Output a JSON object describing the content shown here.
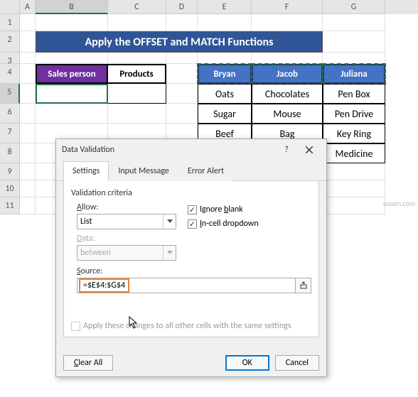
{
  "columns": [
    "A",
    "B",
    "C",
    "D",
    "E",
    "F",
    "G"
  ],
  "rows": [
    "1",
    "2",
    "3",
    "4",
    "5",
    "6",
    "7",
    "8",
    "9",
    "10",
    "11"
  ],
  "banner": "Apply the OFFSET and MATCH Functions",
  "left_headers": {
    "sales": "Sales person",
    "products": "Products"
  },
  "right_headers": [
    "Bryan",
    "Jacob",
    "Juliana"
  ],
  "table": [
    [
      "Oats",
      "Chocolates",
      "Pen Box"
    ],
    [
      "Sugar",
      "Mouse",
      "Pen Drive"
    ],
    [
      "Beef",
      "Bag",
      "Key Ring"
    ],
    [
      "",
      "",
      "Medicine"
    ]
  ],
  "dialog": {
    "title": "Data Validation",
    "tabs": [
      "Settings",
      "Input Message",
      "Error Alert"
    ],
    "criteria": "Validation criteria",
    "allow_lbl": "Allow:",
    "allow_val": "List",
    "data_lbl": "Data:",
    "data_val": "between",
    "ignore": "Ignore blank",
    "incell": "In-cell dropdown",
    "source_lbl": "Source:",
    "source_val": "=$E$4:$G$4",
    "apply": "Apply these changes to all other cells with the same settings",
    "clear": "Clear All",
    "ok": "OK",
    "cancel": "Cancel"
  },
  "watermark": "wsxdn.com",
  "chart_data": {
    "type": "table",
    "title": "Apply the OFFSET and MATCH Functions",
    "left_table": {
      "headers": [
        "Sales person",
        "Products"
      ],
      "rows": [
        [
          "",
          ""
        ]
      ]
    },
    "right_table": {
      "headers": [
        "Bryan",
        "Jacob",
        "Juliana"
      ],
      "rows": [
        [
          "Oats",
          "Chocolates",
          "Pen Box"
        ],
        [
          "Sugar",
          "Mouse",
          "Pen Drive"
        ],
        [
          "Beef",
          "Bag",
          "Key Ring"
        ],
        [
          "",
          "",
          "Medicine"
        ]
      ]
    },
    "validation_source": "=$E$4:$G$4"
  }
}
